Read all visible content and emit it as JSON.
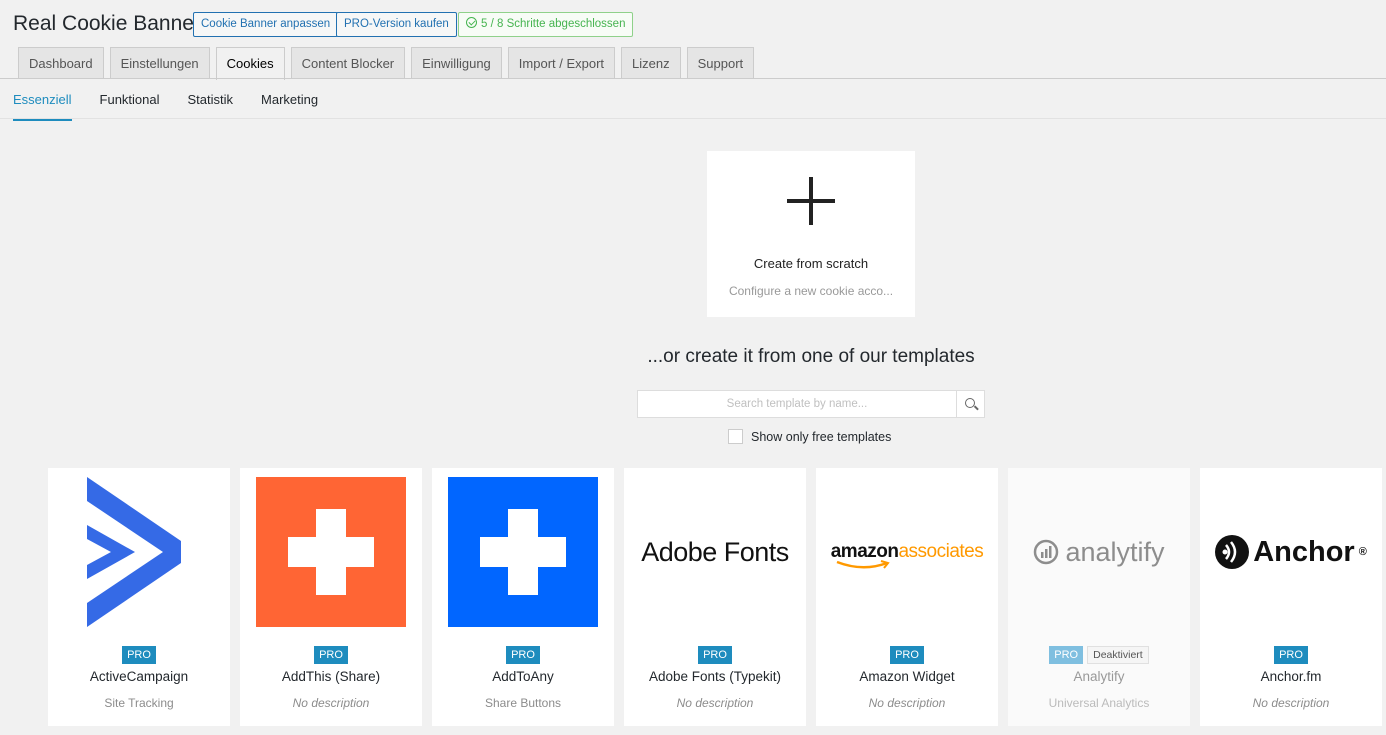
{
  "app": {
    "title": "Real Cookie Banner",
    "header_buttons": {
      "customize": "Cookie Banner anpassen",
      "pro": "PRO-Version kaufen",
      "progress": "5 / 8 Schritte abgeschlossen"
    }
  },
  "nav_tabs": [
    "Dashboard",
    "Einstellungen",
    "Cookies",
    "Content Blocker",
    "Einwilligung",
    "Import / Export",
    "Lizenz",
    "Support"
  ],
  "active_nav_tab": "Cookies",
  "sub_tabs": [
    "Essenziell",
    "Funktional",
    "Statistik",
    "Marketing"
  ],
  "active_sub_tab": "Essenziell",
  "scratch": {
    "title": "Create from scratch",
    "description": "Configure a new cookie acco..."
  },
  "templates_heading": "...or create it from one of our templates",
  "search": {
    "placeholder": "Search template by name...",
    "value": ""
  },
  "free_filter": {
    "label": "Show only free templates",
    "checked": false
  },
  "cards": [
    {
      "name": "ActiveCampaign",
      "description": "Site Tracking",
      "badge": "PRO",
      "logo": "activecampaign-logo"
    },
    {
      "name": "AddThis (Share)",
      "description": "No description",
      "badge": "PRO",
      "logo": "addthis-logo"
    },
    {
      "name": "AddToAny",
      "description": "Share Buttons",
      "badge": "PRO",
      "logo": "addtoany-logo"
    },
    {
      "name": "Adobe Fonts (Typekit)",
      "description": "No description",
      "badge": "PRO",
      "logo_text": "Adobe Fonts"
    },
    {
      "name": "Amazon Widget",
      "description": "No description",
      "badge": "PRO",
      "logo_text_a": "amazon",
      "logo_text_b": "associates"
    },
    {
      "name": "Analytify",
      "description": "Universal Analytics",
      "badge": "PRO",
      "status": "Deaktiviert",
      "logo_text": "analytify"
    },
    {
      "name": "Anchor.fm",
      "description": "No description",
      "badge": "PRO",
      "logo_text": "Anchor",
      "logo_mark": "®"
    }
  ],
  "colors": {
    "accent": "#1e8cbe",
    "addthis": "#ff6534",
    "addtoany": "#0166ff",
    "activecampaign": "#356ae6",
    "amazon_orange": "#ff9900"
  }
}
